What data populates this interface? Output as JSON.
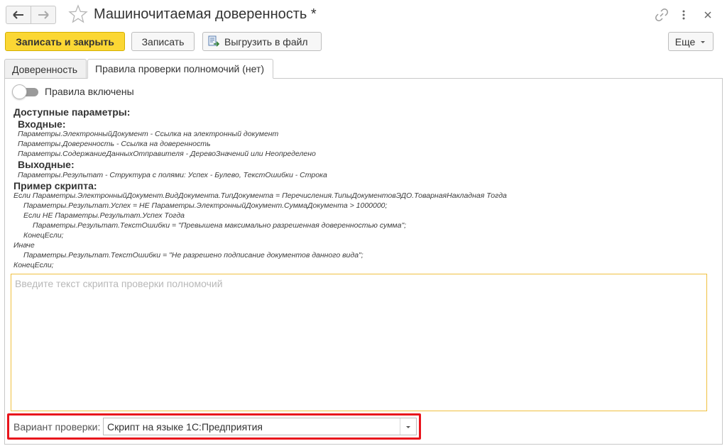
{
  "window": {
    "title": "Машиночитаемая доверенность *"
  },
  "toolbar": {
    "save_close_label": "Записать и закрыть",
    "save_label": "Записать",
    "export_label": "Выгрузить в файл",
    "more_label": "Еще"
  },
  "tabs": [
    {
      "label": "Доверенность",
      "active": false
    },
    {
      "label": "Правила проверки полномочий (нет)",
      "active": true
    }
  ],
  "rules": {
    "toggle_label": "Правила включены",
    "toggle_on": false
  },
  "help": {
    "heading": "Доступные параметры:",
    "inputs_heading": "Входные:",
    "inputs": [
      "Параметры.ЭлектронныйДокумент - Ссылка на электронный документ",
      "Параметры.Доверенность - Ссылка на доверенность",
      "Параметры.СодержаниеДанныхОтправителя - ДеревоЗначений или Неопределено"
    ],
    "outputs_heading": "Выходные:",
    "outputs": [
      "Параметры.Результат - Структура с полями: Успех - Булево, ТекстОшибки - Строка"
    ],
    "example_heading": "Пример скрипта:",
    "example_lines": [
      "Если Параметры.ЭлектронныйДокумент.ВидДокумента.ТипДокумента = Перечисления.ТипыДокументовЭДО.ТоварнаяНакладная Тогда",
      "Параметры.Результат.Успех = НЕ Параметры.ЭлектронныйДокумент.СуммаДокумента > 1000000;",
      "Если НЕ Параметры.Результат.Успех Тогда",
      "Параметры.Результат.ТекстОшибки = \"Превышена максимально разрешенная доверенностью сумма\";",
      "КонецЕсли;",
      "Иначе",
      "Параметры.Результат.ТекстОшибки = \"Не разрешено подписание документов данного вида\";",
      "КонецЕсли;"
    ]
  },
  "script": {
    "value": "",
    "placeholder": "Введите текст скрипта проверки полномочий"
  },
  "variant": {
    "label": "Вариант проверки:",
    "value": "Скрипт на языке 1С:Предприятия"
  },
  "colors": {
    "primary_button": "#fbd734",
    "focus_border": "#f0c040",
    "highlight_frame": "#e8141c"
  }
}
